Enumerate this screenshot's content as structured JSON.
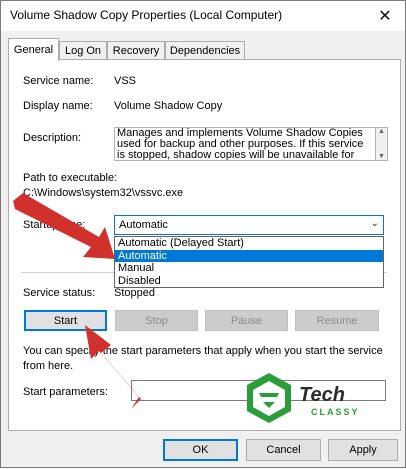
{
  "window": {
    "title": "Volume Shadow Copy Properties (Local Computer)",
    "close_icon": "close-icon"
  },
  "tabs": [
    "General",
    "Log On",
    "Recovery",
    "Dependencies"
  ],
  "general": {
    "service_name_label": "Service name:",
    "service_name_value": "VSS",
    "display_name_label": "Display name:",
    "display_name_value": "Volume Shadow Copy",
    "description_label": "Description:",
    "description_lines": [
      "Manages and implements Volume Shadow Copies",
      "used for backup and other purposes. If this service",
      "is stopped, shadow copies will be unavailable for"
    ],
    "path_label": "Path to executable:",
    "path_value": "C:\\Windows\\system32\\vssvc.exe",
    "startup_type_label": "Startup type:",
    "startup_type_value": "Automatic",
    "startup_options": [
      "Automatic (Delayed Start)",
      "Automatic",
      "Manual",
      "Disabled"
    ],
    "startup_selected_index": 1,
    "service_status_label": "Service status:",
    "service_status_value": "Stopped",
    "buttons": {
      "start": "Start",
      "stop": "Stop",
      "pause": "Pause",
      "resume": "Resume"
    },
    "help_line1": "You can specify the start parameters that apply when you start the service",
    "help_line2": "from here.",
    "start_params_label": "Start parameters:",
    "start_params_value": ""
  },
  "logo": {
    "text_top": "Tech",
    "text_bottom": "CLASSY",
    "colors": {
      "green": "#2a9d3a",
      "dark": "#2b2b2b"
    }
  },
  "footer": {
    "ok": "OK",
    "cancel": "Cancel",
    "apply": "Apply"
  },
  "colors": {
    "accent": "#0078d7",
    "arrow": "#d0312d"
  }
}
